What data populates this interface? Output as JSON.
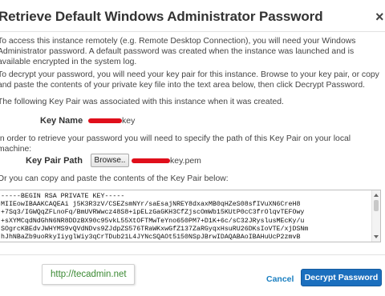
{
  "dialog": {
    "title": "Retrieve Default Windows Administrator Password",
    "close_glyph": "×"
  },
  "intro": {
    "para1": "To access this instance remotely (e.g. Remote Desktop Connection), you will need your Windows Administrator password. A default password was created when the instance was launched and is available encrypted in the system log.",
    "para2": "To decrypt your password, you will need your key pair for this instance. Browse to your key pair, or copy and paste the contents of your private key file into the text area below, then click Decrypt Password.",
    "para3": "The following Key Pair was associated with this instance when it was created."
  },
  "key_name": {
    "label": "Key Name",
    "value_suffix": "key"
  },
  "path_instructions": "In order to retrieve your password you will need to specify the path of this Key Pair on your local machine:",
  "key_pair_path": {
    "label": "Key Pair Path",
    "browse_label": "Browse..",
    "value_suffix": "key.pem"
  },
  "paste_instructions": "Or you can copy and paste the contents of the Key Pair below:",
  "private_key": {
    "lines": [
      "-----BEGIN RSA PRIVATE KEY-----",
      "MIIEowIBAAKCAQEAi j5K3R3zV/CSEZsmNYr/saEsajNREY8dxaxMB0qHZeS08sfIVuXN6CreH8",
      "+7Sq3/IGWQqZFLnoFq/BmUVRWwcz48S8+ipELzGaGKH3CfZjscOmWb15KUtP0cC3frOlqvTEFOwy",
      "+sXYMCqdNdGhN6NR8DDzBX90c95vkL55XtOFTMwTeYno650PM7+D1K+6c/sC32JRyslusMEcKy/u",
      "SOgrcKBEdvJWHYMS9vQVdNDvs9ZJdpZS576TRaWKxwGfZ137ZaRGyqxHsuRU26DKsIoVTE/xjDSNm",
      "hJhNBaZb9uoRkyIiyglWiy3qCrTDub21L4JYNcSQAOt5150NSpJBrwIDAQABAoIBAHuUcP2zmvB"
    ]
  },
  "footer": {
    "watermark": "http://tecadmin.net",
    "cancel_label": "Cancel",
    "decrypt_label": "Decrypt Password"
  },
  "colors": {
    "accent": "#1b6fbe",
    "link": "#1a7fc1",
    "redaction": "#e00f1b",
    "watermark_text": "#3c8a34"
  },
  "icons": [
    "close-icon",
    "scroll-up-icon",
    "scroll-down-icon"
  ]
}
